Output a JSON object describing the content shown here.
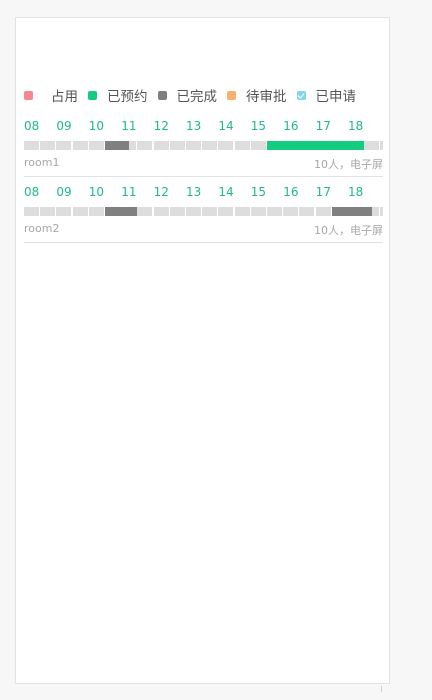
{
  "legend": [
    {
      "label": "占用",
      "color": "#f4888c",
      "key": "occupied"
    },
    {
      "label": "已预约",
      "color": "#14cc80",
      "key": "booked"
    },
    {
      "label": "已完成",
      "color": "#808080",
      "key": "done"
    },
    {
      "label": "待审批",
      "color": "#f9b16e",
      "key": "pending"
    },
    {
      "label": "已申请",
      "color": "#7fd6ee",
      "key": "applied",
      "icon": "checkbox-checked-icon"
    }
  ],
  "hours": [
    "08",
    "09",
    "10",
    "11",
    "12",
    "13",
    "14",
    "15",
    "16",
    "17",
    "18"
  ],
  "rooms": [
    {
      "name": "room1",
      "meta": "10人，电子屏",
      "bookings": [
        {
          "status": "done",
          "start": "10:30",
          "end": "11:15"
        },
        {
          "status": "booked",
          "start": "15:30",
          "end": "18:30"
        }
      ]
    },
    {
      "name": "room2",
      "meta": "10人，电子屏",
      "bookings": [
        {
          "status": "done",
          "start": "10:30",
          "end": "11:30"
        },
        {
          "status": "done",
          "start": "17:30",
          "end": "18:45"
        }
      ]
    }
  ]
}
